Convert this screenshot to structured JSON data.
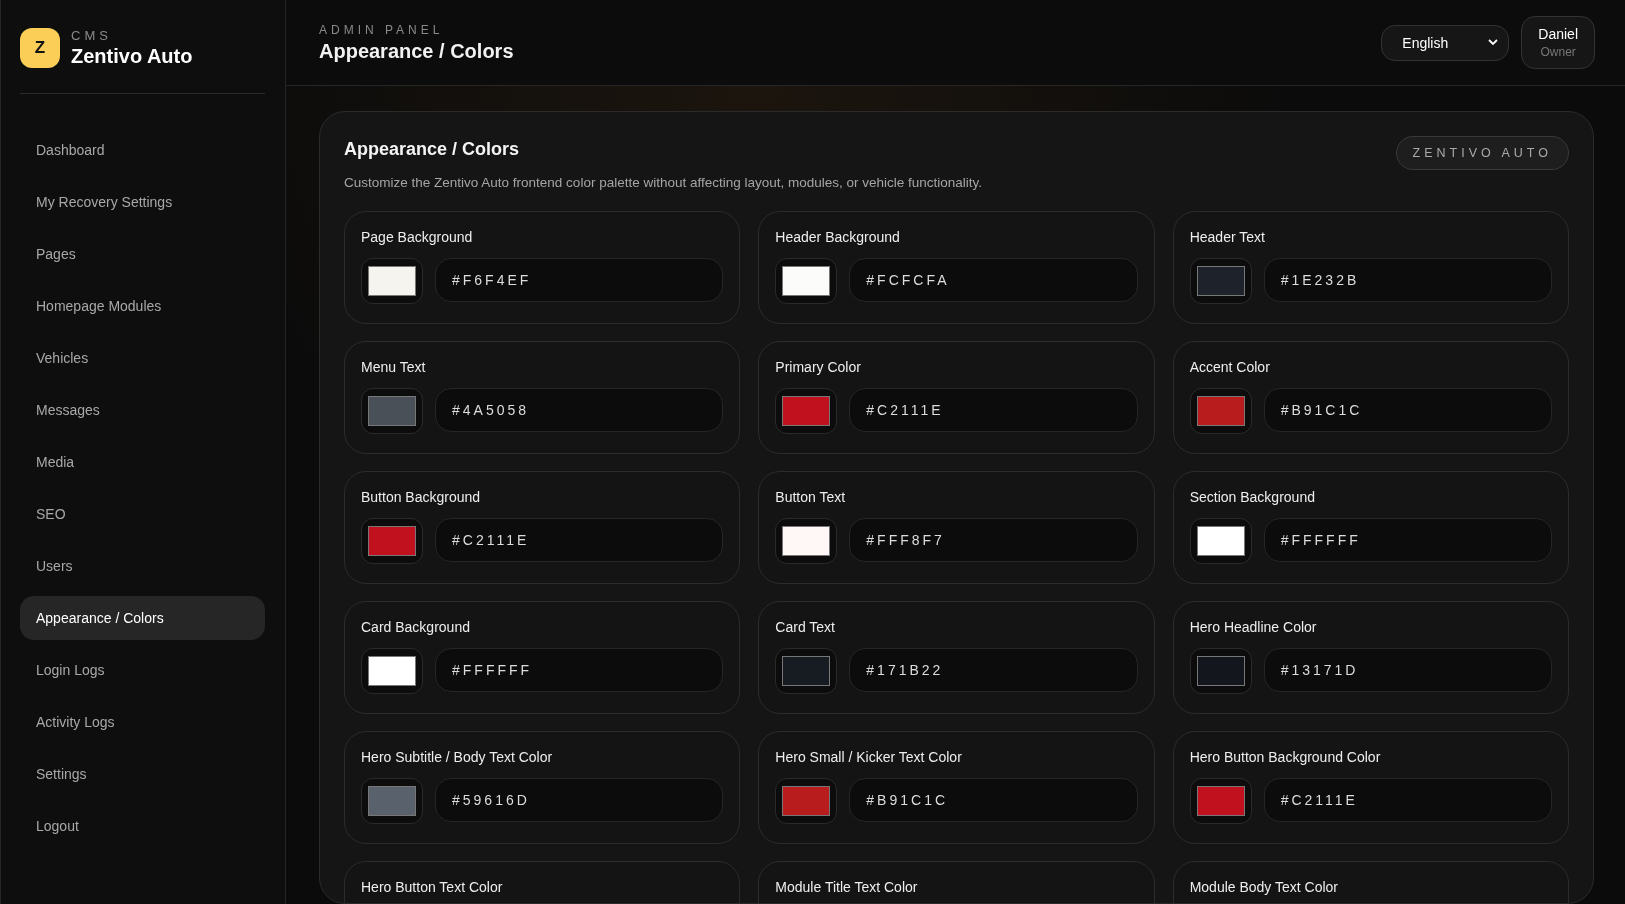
{
  "brand": {
    "logo_letter": "Z",
    "kicker": "CMS",
    "name": "Zentivo Auto"
  },
  "sidebar": {
    "items": [
      {
        "label": "Dashboard",
        "selected": false
      },
      {
        "label": "My Recovery Settings",
        "selected": false
      },
      {
        "label": "Pages",
        "selected": false
      },
      {
        "label": "Homepage Modules",
        "selected": false
      },
      {
        "label": "Vehicles",
        "selected": false
      },
      {
        "label": "Messages",
        "selected": false
      },
      {
        "label": "Media",
        "selected": false
      },
      {
        "label": "SEO",
        "selected": false
      },
      {
        "label": "Users",
        "selected": false
      },
      {
        "label": "Appearance / Colors",
        "selected": true
      },
      {
        "label": "Login Logs",
        "selected": false
      },
      {
        "label": "Activity Logs",
        "selected": false
      },
      {
        "label": "Settings",
        "selected": false
      },
      {
        "label": "Logout",
        "selected": false
      }
    ]
  },
  "header": {
    "kicker": "ADMIN PANEL",
    "title": "Appearance / Colors",
    "language": "English",
    "user": {
      "name": "Daniel",
      "role": "Owner"
    }
  },
  "panel": {
    "title": "Appearance / Colors",
    "description": "Customize the Zentivo Auto frontend color palette without affecting layout, modules, or vehicle functionality.",
    "badge": "ZENTIVO AUTO",
    "colors": [
      {
        "label": "Page Background",
        "value": "#F6F4EF",
        "color": "#f6f4ef"
      },
      {
        "label": "Header Background",
        "value": "#FCFCFA",
        "color": "#fcfcfa"
      },
      {
        "label": "Header Text",
        "value": "#1E232B",
        "color": "#1e232b"
      },
      {
        "label": "Menu Text",
        "value": "#4A5058",
        "color": "#4a5058"
      },
      {
        "label": "Primary Color",
        "value": "#C2111E",
        "color": "#c2111e"
      },
      {
        "label": "Accent Color",
        "value": "#B91C1C",
        "color": "#b91c1c"
      },
      {
        "label": "Button Background",
        "value": "#C2111E",
        "color": "#c2111e"
      },
      {
        "label": "Button Text",
        "value": "#FFF8F7",
        "color": "#fff8f7"
      },
      {
        "label": "Section Background",
        "value": "#FFFFFF",
        "color": "#ffffff"
      },
      {
        "label": "Card Background",
        "value": "#FFFFFF",
        "color": "#ffffff"
      },
      {
        "label": "Card Text",
        "value": "#171B22",
        "color": "#171b22"
      },
      {
        "label": "Hero Headline Color",
        "value": "#13171D",
        "color": "#13171d"
      },
      {
        "label": "Hero Subtitle / Body Text Color",
        "value": "#59616D",
        "color": "#59616d"
      },
      {
        "label": "Hero Small / Kicker Text Color",
        "value": "#B91C1C",
        "color": "#b91c1c"
      },
      {
        "label": "Hero Button Background Color",
        "value": "#C2111E",
        "color": "#c2111e"
      },
      {
        "label": "Hero Button Text Color"
      },
      {
        "label": "Module Title Text Color"
      },
      {
        "label": "Module Body Text Color"
      }
    ]
  }
}
